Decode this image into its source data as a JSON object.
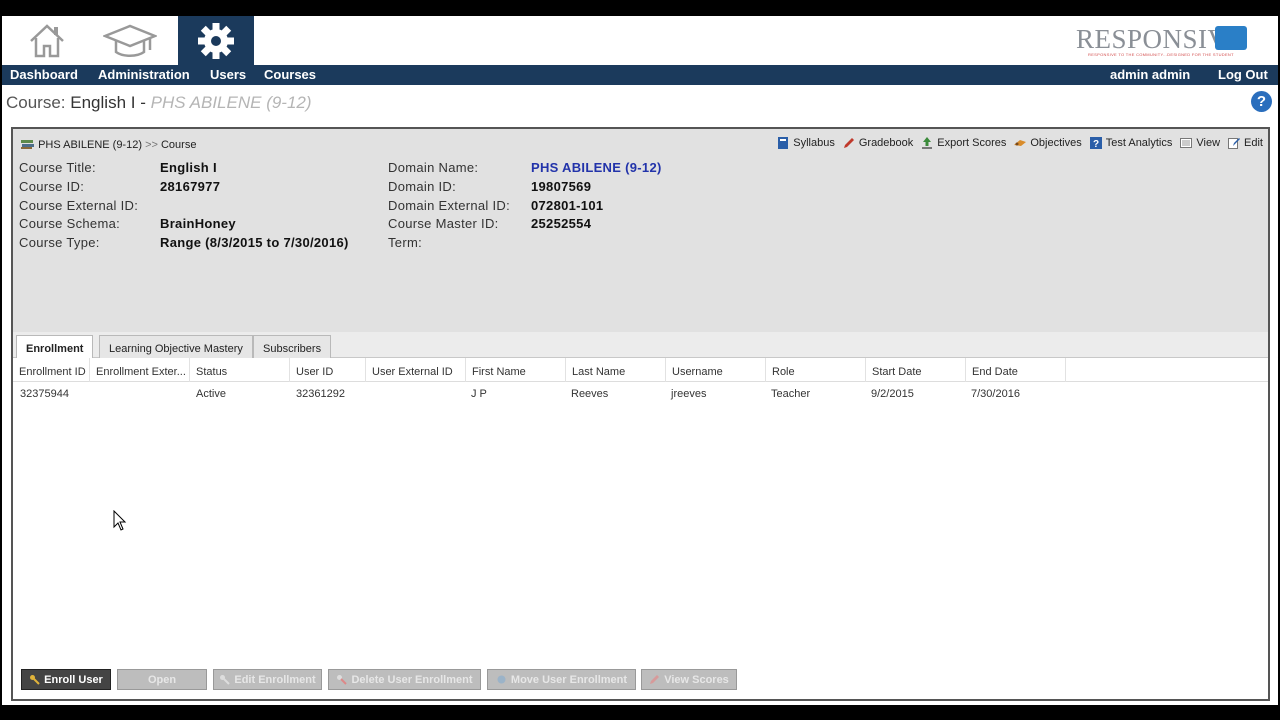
{
  "brand": {
    "logo_text": "RESPONSIVE",
    "tagline": "RESPONSIVE TO THE COMMUNITY...DESIGNED FOR THE STUDENT"
  },
  "nav": {
    "left": [
      "Dashboard",
      "Administration",
      "Users",
      "Courses"
    ],
    "user": "admin admin",
    "logout": "Log Out"
  },
  "page": {
    "label": "Course:",
    "course": "English I",
    "sep": "-",
    "domain": "PHS ABILENE (9-12)",
    "help": "?"
  },
  "breadcrumb": {
    "domain": "PHS ABILENE (9-12)",
    "sep": ">>",
    "current": "Course"
  },
  "toolbar": [
    "Syllabus",
    "Gradebook",
    "Export Scores",
    "Objectives",
    "Test Analytics",
    "View",
    "Edit"
  ],
  "details_left": [
    {
      "label": "Course Title:",
      "value": "English I"
    },
    {
      "label": "Course ID:",
      "value": "28167977"
    },
    {
      "label": "Course External ID:",
      "value": ""
    },
    {
      "label": "Course Schema:",
      "value": "BrainHoney"
    },
    {
      "label": "Course Type:",
      "value": "Range (8/3/2015 to 7/30/2016)"
    }
  ],
  "details_right": [
    {
      "label": "Domain Name:",
      "value": "PHS ABILENE (9-12)"
    },
    {
      "label": "Domain ID:",
      "value": "19807569"
    },
    {
      "label": "Domain External ID:",
      "value": "072801-101"
    },
    {
      "label": "Course Master ID:",
      "value": "25252554"
    },
    {
      "label": "Term:",
      "value": ""
    }
  ],
  "tabs": [
    "Enrollment",
    "Learning Objective Mastery",
    "Subscribers"
  ],
  "grid": {
    "columns": [
      "Enrollment ID",
      "Enrollment Exter...",
      "Status",
      "User ID",
      "User External ID",
      "First Name",
      "Last Name",
      "Username",
      "Role",
      "Start Date",
      "End Date"
    ],
    "rows": [
      [
        "32375944",
        "",
        "Active",
        "32361292",
        "",
        "J P",
        "Reeves",
        "jreeves",
        "Teacher",
        "9/2/2015",
        "7/30/2016"
      ]
    ]
  },
  "actions": [
    "Enroll User",
    "Open",
    "Edit Enrollment",
    "Delete User Enrollment",
    "Move User Enrollment",
    "View Scores"
  ],
  "colors": {
    "nav_bg": "#1b3a5c",
    "link": "#2233aa",
    "help": "#2a6ebd"
  }
}
